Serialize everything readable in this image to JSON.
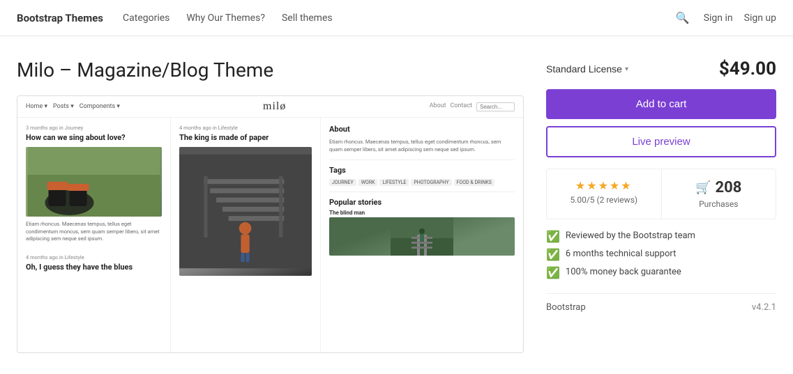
{
  "navbar": {
    "brand": "Bootstrap Themes",
    "links": [
      "Categories",
      "Why Our Themes?",
      "Sell themes"
    ],
    "sign_in": "Sign in",
    "sign_up": "Sign up"
  },
  "page": {
    "title": "Milo – Magazine/Blog Theme"
  },
  "theme_preview": {
    "nav_links": [
      "Home ▾",
      "Posts ▾",
      "Components ▾"
    ],
    "brand_name": "milø",
    "nav_right_links": [
      "About",
      "Contact"
    ],
    "search_placeholder": "Search...",
    "article1": {
      "meta": "3 months ago in Journey",
      "title": "How can we sing about love?"
    },
    "article2": {
      "meta": "4 months ago in Lifestyle",
      "title": "The king is made of paper"
    },
    "article3": {
      "meta": "4 months ago in Lifestyle",
      "title": "Oh, I guess they have the blues"
    },
    "article1_text": "Etiam rhoncus. Maecenas tempus, tellus eget condimentum moncus, sem quam semper libero, sit amet adipiscing sem neque sed ipsum.",
    "about_title": "About",
    "about_text": "Etiam rhoncus. Maecenas tempus, tellus eget condimentum rhoncus, sem quam semper libero, sit amet adipiscing sem neque sed ipsum.",
    "tags_title": "Tags",
    "tags": [
      "JOURNEY",
      "WORK",
      "LIFESTYLE",
      "PHOTOGRAPHY",
      "FOOD & DRINKS"
    ],
    "popular_title": "Popular stories",
    "popular_item": "The blind man"
  },
  "sidebar": {
    "license_label": "Standard License",
    "price": "$49.00",
    "add_to_cart": "Add to cart",
    "live_preview": "Live preview",
    "rating": "5.00/5 (2 reviews)",
    "stars": "★★★★★",
    "purchases_count": "208",
    "purchases_label": "Purchases",
    "features": [
      "Reviewed by the Bootstrap team",
      "6 months technical support",
      "100% money back guarantee"
    ],
    "bootstrap_label": "Bootstrap",
    "bootstrap_version": "v4.2.1"
  }
}
